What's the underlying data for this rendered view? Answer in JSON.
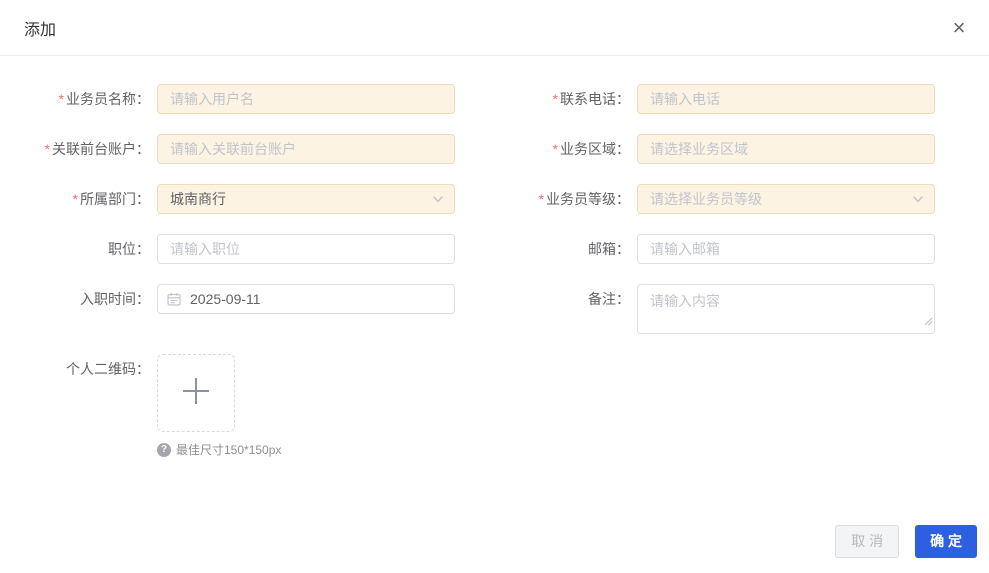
{
  "dialog": {
    "title": "添加",
    "close_icon": "×"
  },
  "form": {
    "required_mark": "*",
    "fields": {
      "name": {
        "label": "业务员名称：",
        "placeholder": "请输入用户名"
      },
      "phone": {
        "label": "联系电话：",
        "placeholder": "请输入电话"
      },
      "front_account": {
        "label": "关联前台账户：",
        "placeholder": "请输入关联前台账户"
      },
      "region": {
        "label": "业务区域：",
        "placeholder": "请选择业务区域"
      },
      "department": {
        "label": "所属部门：",
        "value": "城南商行"
      },
      "level": {
        "label": "业务员等级：",
        "placeholder": "请选择业务员等级"
      },
      "position": {
        "label": "职位：",
        "placeholder": "请输入职位"
      },
      "email": {
        "label": "邮箱：",
        "placeholder": "请输入邮箱"
      },
      "entry_date": {
        "label": "入职时间：",
        "value": "2025-09-11"
      },
      "remark": {
        "label": "备注：",
        "placeholder": "请输入内容"
      },
      "qrcode": {
        "label": "个人二维码：",
        "hint": "最佳尺寸150*150px",
        "hint_icon": "?"
      }
    }
  },
  "footer": {
    "cancel_label": "取 消",
    "confirm_label": "确 定"
  },
  "colors": {
    "primary": "#2d5fe3",
    "required": "#f56c6c",
    "warn_bg": "#fdf3e3",
    "warn_border": "#eedcba"
  }
}
